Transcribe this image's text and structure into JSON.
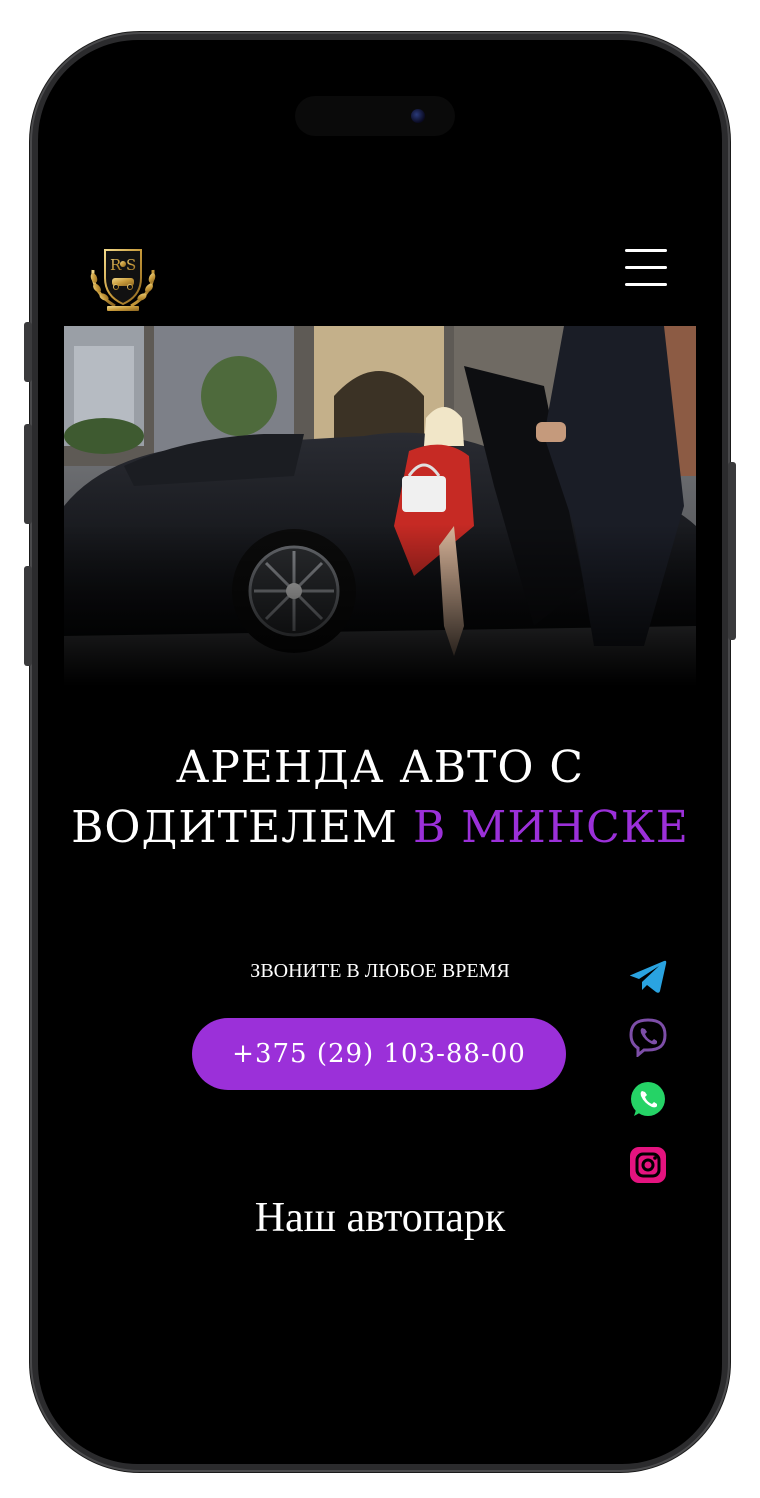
{
  "header": {
    "logo_text": "RS",
    "logo_subtext": "RENT SERVICES",
    "menu_icon": "hamburger-menu-icon"
  },
  "hero": {
    "image_alt": "chauffeur opening rear door of a black sedan for a woman in red",
    "headline_line1": "АРЕНДА АВТО С",
    "headline_line2_main": "ВОДИТЕЛЕМ",
    "headline_line2_accent": "В МИНСКЕ"
  },
  "contact": {
    "caption": "ЗВОНИТЕ В ЛЮБОЕ ВРЕМЯ",
    "phone": "+375 (29) 103-88-00"
  },
  "social": [
    {
      "name": "telegram-icon",
      "color": "#2aa3e0"
    },
    {
      "name": "viber-icon",
      "color": "#7d4ea8"
    },
    {
      "name": "whatsapp-icon",
      "color": "#25d366"
    },
    {
      "name": "instagram-icon",
      "color": "#e4137f"
    }
  ],
  "section": {
    "autopark_title": "Наш автопарк"
  },
  "colors": {
    "accent": "#9b30d9",
    "background": "#000000"
  }
}
